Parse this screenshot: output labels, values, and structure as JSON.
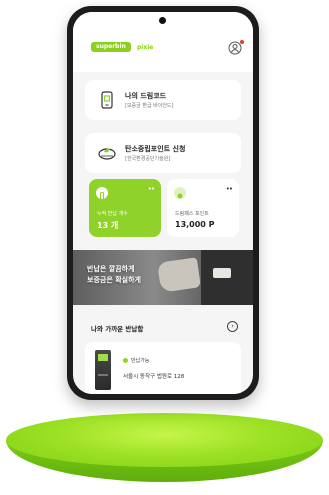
{
  "app": {
    "logo_badge": "superbin",
    "logo_suffix": "pixie"
  },
  "menu": {
    "items": [
      {
        "title": "나의 드림코드",
        "subtitle": "[보증금 환급 바이언드]"
      },
      {
        "title": "탄소중립포인트 신청",
        "subtitle": "[한국환경공단기술원]"
      }
    ]
  },
  "stats": [
    {
      "label": "누적 반납 개수",
      "value": "13 개",
      "more": "••"
    },
    {
      "label": "드림패스 포인트",
      "value": "13,000 P",
      "more": "••"
    }
  ],
  "banner": {
    "line1": "반납은 깔끔하게",
    "line2": "보증금은 확실하게"
  },
  "nearby": {
    "title": "나와 가까운 반납함",
    "arrow": "›",
    "machine": {
      "status": "반납가능",
      "address": "서울시 동작구 법원로 128"
    }
  },
  "colors": {
    "brand_green": "#8fd22a",
    "podium_green": "#9be023",
    "phone_body": "#1c1c1e",
    "notification": "#e53935"
  }
}
